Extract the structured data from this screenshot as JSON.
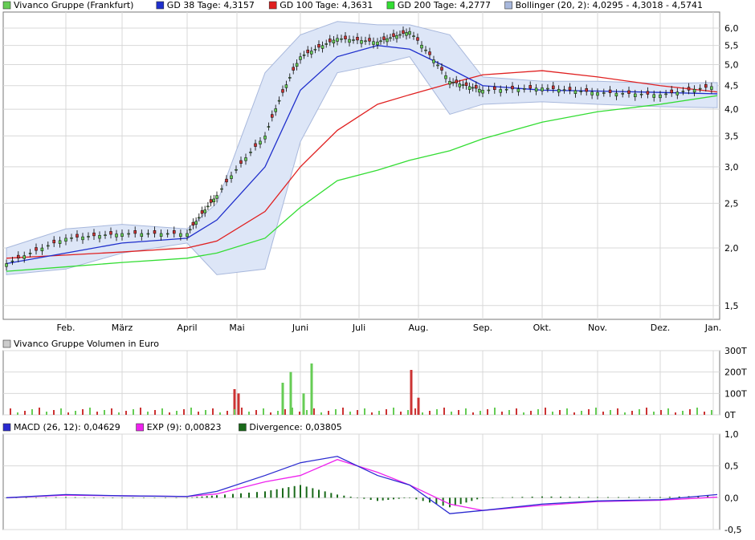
{
  "colors": {
    "price_up": "#66cc55",
    "price_down": "#cc3333",
    "gd38": "#1f2fcc",
    "gd100": "#e02020",
    "gd200": "#33dd33",
    "bollinger_fill": "#dde6f7",
    "bollinger_line": "#a8b8dc",
    "macd": "#2a2ad0",
    "exp": "#ee22ee",
    "divergence": "#1a6a1a",
    "grid": "#d8d8d8",
    "frame": "#777777"
  },
  "legend_price": [
    {
      "label": "Vivanco Gruppe (Frankfurt)",
      "swatch": "#66cc55"
    },
    {
      "label": "GD 38 Tage: 4,3157",
      "swatch": "#1f2fcc"
    },
    {
      "label": "GD 100 Tage: 4,3631",
      "swatch": "#e02020"
    },
    {
      "label": "GD 200 Tage: 4,2777",
      "swatch": "#33dd33"
    },
    {
      "label": "Bollinger (20, 2): 4,0295 - 4,3018 - 4,5741",
      "swatch": "#a8b8dc"
    }
  ],
  "legend_volume": [
    {
      "label": "Vivanco Gruppe Volumen in Euro",
      "swatch": "#cccccc"
    }
  ],
  "legend_macd": [
    {
      "label": "MACD (26, 12): 0,04629",
      "swatch": "#2a2ad0"
    },
    {
      "label": "EXP (9): 0,00823",
      "swatch": "#ee22ee"
    },
    {
      "label": "Divergence: 0,03805",
      "swatch": "#1a6a1a"
    }
  ],
  "chart_data": [
    {
      "type": "line",
      "scale": "log",
      "x_ticks": [
        "Feb.",
        "März",
        "April",
        "Mai",
        "Juni",
        "Juli",
        "Aug.",
        "Sep.",
        "Okt.",
        "Nov.",
        "Dez.",
        "Jan."
      ],
      "y_ticks": [
        "1,5",
        "2,0",
        "2,5",
        "3,0",
        "3,5",
        "4,0",
        "4,5",
        "5,0",
        "5,5",
        "6,0"
      ],
      "y_tick_values": [
        1.5,
        2.0,
        2.5,
        3.0,
        3.5,
        4.0,
        4.5,
        5.0,
        5.5,
        6.0
      ],
      "ylim": [
        1.4,
        6.5
      ],
      "grid": true,
      "x": [
        "Jan.",
        "Feb.",
        "März",
        "April",
        "Mai",
        "Mai",
        "Juni",
        "Juni",
        "Juli",
        "Aug.",
        "Aug.",
        "Sep.",
        "Okt.",
        "Nov.",
        "Dez.",
        "Jan."
      ],
      "series": [
        {
          "name": "Vivanco Gruppe (Frankfurt)",
          "values": [
            1.85,
            2.1,
            2.15,
            2.15,
            2.6,
            3.5,
            5.2,
            5.7,
            5.6,
            5.9,
            4.6,
            4.4,
            4.45,
            4.35,
            4.3,
            4.5
          ]
        },
        {
          "name": "GD 38 Tage",
          "values": [
            1.85,
            1.95,
            2.05,
            2.1,
            2.3,
            3.0,
            4.4,
            5.2,
            5.5,
            5.4,
            4.9,
            4.5,
            4.4,
            4.38,
            4.35,
            4.32
          ]
        },
        {
          "name": "GD 100 Tage",
          "values": [
            1.9,
            1.93,
            1.96,
            2.0,
            2.07,
            2.4,
            3.0,
            3.6,
            4.1,
            4.3,
            4.55,
            4.75,
            4.85,
            4.7,
            4.5,
            4.36
          ]
        },
        {
          "name": "GD 200 Tage",
          "values": [
            1.78,
            1.82,
            1.86,
            1.9,
            1.95,
            2.1,
            2.45,
            2.8,
            2.95,
            3.1,
            3.25,
            3.45,
            3.75,
            3.95,
            4.1,
            4.28
          ]
        }
      ],
      "bollinger": {
        "upper": [
          2.0,
          2.2,
          2.25,
          2.2,
          2.5,
          4.8,
          5.8,
          6.2,
          6.1,
          6.1,
          5.8,
          4.7,
          4.6,
          4.6,
          4.55,
          4.57
        ],
        "lower": [
          1.75,
          1.8,
          1.95,
          2.05,
          1.75,
          1.8,
          3.4,
          4.8,
          5.0,
          5.2,
          3.9,
          4.1,
          4.15,
          4.1,
          4.05,
          4.03
        ]
      }
    },
    {
      "type": "bar",
      "title": "Vivanco Gruppe Volumen in Euro",
      "y_ticks": [
        "0T",
        "100T",
        "200T",
        "300T"
      ],
      "ylim": [
        0,
        300
      ],
      "bars": [
        {
          "x": "Mai",
          "value": 120,
          "dir": "down"
        },
        {
          "x": "Mai",
          "value": 100,
          "dir": "down"
        },
        {
          "x": "Juni",
          "value": 150,
          "dir": "up"
        },
        {
          "x": "Juni",
          "value": 200,
          "dir": "up"
        },
        {
          "x": "Juni",
          "value": 100,
          "dir": "up"
        },
        {
          "x": "Juni",
          "value": 240,
          "dir": "up"
        },
        {
          "x": "Aug.",
          "value": 210,
          "dir": "down"
        },
        {
          "x": "Aug.",
          "value": 80,
          "dir": "down"
        }
      ]
    },
    {
      "type": "line",
      "y_ticks": [
        "-0,5",
        "0,0",
        "0,5",
        "1,0"
      ],
      "ylim": [
        -0.5,
        1.0
      ],
      "series": [
        {
          "name": "MACD (26, 12)",
          "values": [
            0.0,
            0.05,
            0.03,
            0.02,
            0.1,
            0.35,
            0.55,
            0.65,
            0.35,
            0.2,
            -0.25,
            -0.2,
            -0.1,
            -0.05,
            -0.03,
            0.05
          ]
        },
        {
          "name": "EXP (9)",
          "values": [
            0.0,
            0.04,
            0.03,
            0.02,
            0.06,
            0.25,
            0.35,
            0.6,
            0.4,
            0.2,
            -0.1,
            -0.2,
            -0.12,
            -0.06,
            -0.04,
            0.01
          ]
        },
        {
          "name": "Divergence",
          "values": [
            0.0,
            0.01,
            0.0,
            0.0,
            0.04,
            0.1,
            0.2,
            0.05,
            -0.05,
            0.0,
            -0.15,
            0.0,
            0.02,
            0.01,
            0.01,
            0.04
          ]
        }
      ]
    }
  ]
}
